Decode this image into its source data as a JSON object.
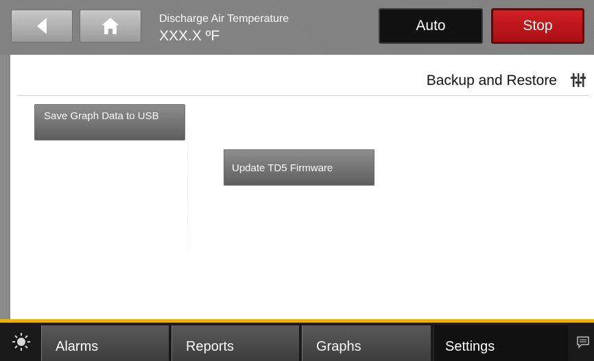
{
  "header": {
    "temperature_label": "Discharge Air Temperature",
    "temperature_value": "XXX.X ºF",
    "auto_label": "Auto",
    "stop_label": "Stop",
    "icons": {
      "back": "back-arrow-icon",
      "home": "home-icon"
    }
  },
  "main": {
    "title": "Backup and Restore",
    "title_icon": "settings-sliders-icon",
    "buttons": {
      "save_graph": "Save Graph Data to USB",
      "update_firmware": "Update TD5 Firmware"
    }
  },
  "footer": {
    "tabs": [
      "Alarms",
      "Reports",
      "Graphs",
      "Settings"
    ],
    "active_tab": "Settings",
    "icons": {
      "left": "brightness-icon",
      "right": "message-icon"
    }
  },
  "colors": {
    "stop_red": "#c41a1f",
    "accent_yellow": "#e8b400",
    "auto_black": "#111111"
  }
}
